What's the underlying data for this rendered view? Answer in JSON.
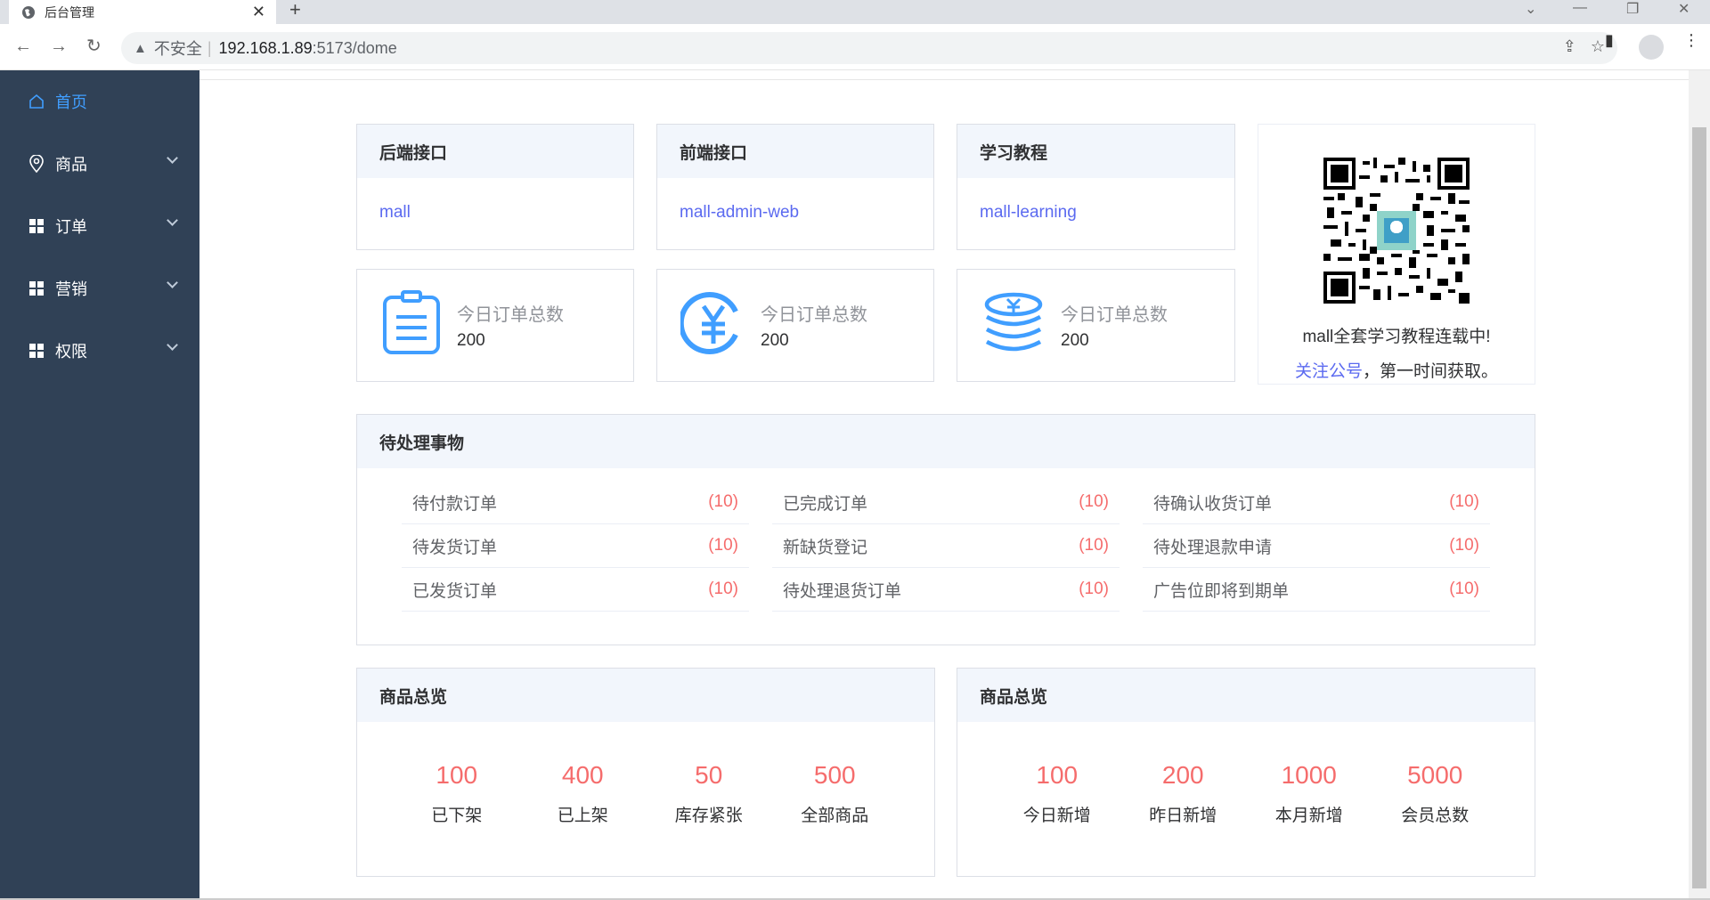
{
  "browser": {
    "tab_title": "后台管理",
    "insecure_label": "不安全",
    "separator": "|",
    "url_host": "192.168.1.89",
    "url_path": ":5173/dome"
  },
  "sidebar": {
    "items": [
      {
        "label": "首页",
        "icon": "home-icon",
        "active": true
      },
      {
        "label": "商品",
        "icon": "location-icon"
      },
      {
        "label": "订单",
        "icon": "grid-icon"
      },
      {
        "label": "营销",
        "icon": "grid-icon"
      },
      {
        "label": "权限",
        "icon": "grid-icon"
      }
    ]
  },
  "links": [
    {
      "title": "后端接口",
      "link": "mall"
    },
    {
      "title": "前端接口",
      "link": "mall-admin-web"
    },
    {
      "title": "学习教程",
      "link": "mall-learning"
    }
  ],
  "stats": [
    {
      "label": "今日订单总数",
      "value": "200",
      "icon": "clipboard-icon"
    },
    {
      "label": "今日订单总数",
      "value": "200",
      "icon": "yen-icon"
    },
    {
      "label": "今日订单总数",
      "value": "200",
      "icon": "coins-icon"
    }
  ],
  "qr": {
    "line1": "mall全套学习教程连载中!",
    "link": "关注公号",
    "line2_rest": "，第一时间获取。"
  },
  "todo": {
    "title": "待处理事物",
    "columns": [
      [
        {
          "label": "待付款订单",
          "count": "(10)"
        },
        {
          "label": "待发货订单",
          "count": "(10)"
        },
        {
          "label": "已发货订单",
          "count": "(10)"
        }
      ],
      [
        {
          "label": "已完成订单",
          "count": "(10)"
        },
        {
          "label": "新缺货登记",
          "count": "(10)"
        },
        {
          "label": "待处理退货订单",
          "count": "(10)"
        }
      ],
      [
        {
          "label": "待确认收货订单",
          "count": "(10)"
        },
        {
          "label": "待处理退款申请",
          "count": "(10)"
        },
        {
          "label": "广告位即将到期单",
          "count": "(10)"
        }
      ]
    ]
  },
  "overview_left": {
    "title": "商品总览",
    "items": [
      {
        "num": "100",
        "cap": "已下架"
      },
      {
        "num": "400",
        "cap": "已上架"
      },
      {
        "num": "50",
        "cap": "库存紧张"
      },
      {
        "num": "500",
        "cap": "全部商品"
      }
    ]
  },
  "overview_right": {
    "title": "商品总览",
    "items": [
      {
        "num": "100",
        "cap": "今日新增"
      },
      {
        "num": "200",
        "cap": "昨日新增"
      },
      {
        "num": "1000",
        "cap": "本月新增"
      },
      {
        "num": "5000",
        "cap": "会员总数"
      }
    ]
  },
  "colors": {
    "sidebar": "#304156",
    "active": "#409eff",
    "accent_red": "#f56c6c",
    "link": "#5b6af0"
  }
}
